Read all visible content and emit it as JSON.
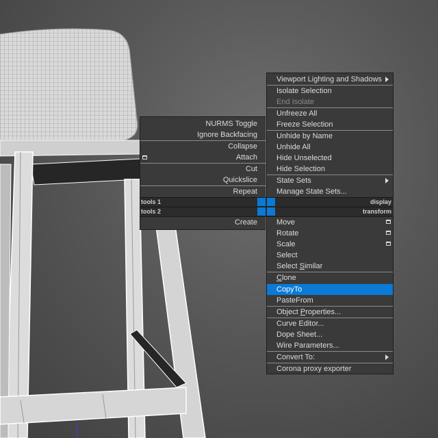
{
  "colors": {
    "highlight": "#0a7ad6",
    "menu_bg": "#3a3a3a",
    "text": "#dcdcdc",
    "disabled": "#8a8a8a"
  },
  "left_quad": {
    "items": [
      "NURMS Toggle",
      "Ignore Backfacing",
      "Collapse",
      "Attach",
      "Cut",
      "Quickslice",
      "Repeat",
      "Create"
    ]
  },
  "headers": {
    "tools1": "tools 1",
    "tools2": "tools 2",
    "display": "display",
    "transform": "transform"
  },
  "right_quad": {
    "viewport_lighting": "Viewport Lighting and Shadows",
    "isolate_selection": "Isolate Selection",
    "end_isolate": "End Isolate",
    "unfreeze_all": "Unfreeze All",
    "freeze_selection": "Freeze Selection",
    "unhide_by_name": "Unhide by Name",
    "unhide_all": "Unhide All",
    "hide_unselected": "Hide Unselected",
    "hide_selection": "Hide Selection",
    "state_sets": "State Sets",
    "manage_state_sets": "Manage State Sets...",
    "move": "Move",
    "rotate": "Rotate",
    "scale": "Scale",
    "select": "Select",
    "select_similar_pre": "Select ",
    "select_similar_u": "S",
    "select_similar_post": "imilar",
    "clone_u": "C",
    "clone_post": "lone",
    "copyto": "CopyTo",
    "pastefrom": "PasteFrom",
    "object_properties_pre": "Object ",
    "object_properties_u": "P",
    "object_properties_post": "roperties...",
    "curve_editor": "Curve Editor...",
    "dope_sheet": "Dope Sheet...",
    "wire_parameters": "Wire Parameters...",
    "convert_to": "Convert To:",
    "corona_proxy": "Corona proxy exporter"
  }
}
